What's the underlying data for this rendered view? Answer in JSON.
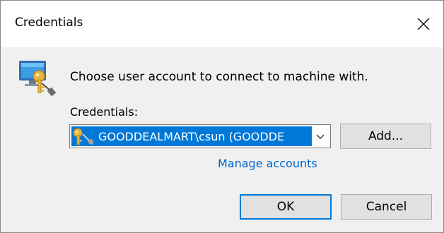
{
  "window": {
    "title": "Credentials",
    "close_icon": "close-icon"
  },
  "main": {
    "header_icon": "computer-key-icon",
    "prompt": "Choose user account to connect to machine with.",
    "credentials_label": "Credentials:",
    "credentials_select": {
      "selected_value": "GOODDEALMART\\csun (GOODDE",
      "icon": "key-icon",
      "arrow_icon": "chevron-down-icon"
    },
    "add_button": "Add...",
    "manage_link": "Manage accounts"
  },
  "footer": {
    "ok_button": "OK",
    "cancel_button": "Cancel"
  },
  "colors": {
    "accent": "#0078d7",
    "link": "#0066cc",
    "dialog_bg": "#f0f0f0"
  }
}
